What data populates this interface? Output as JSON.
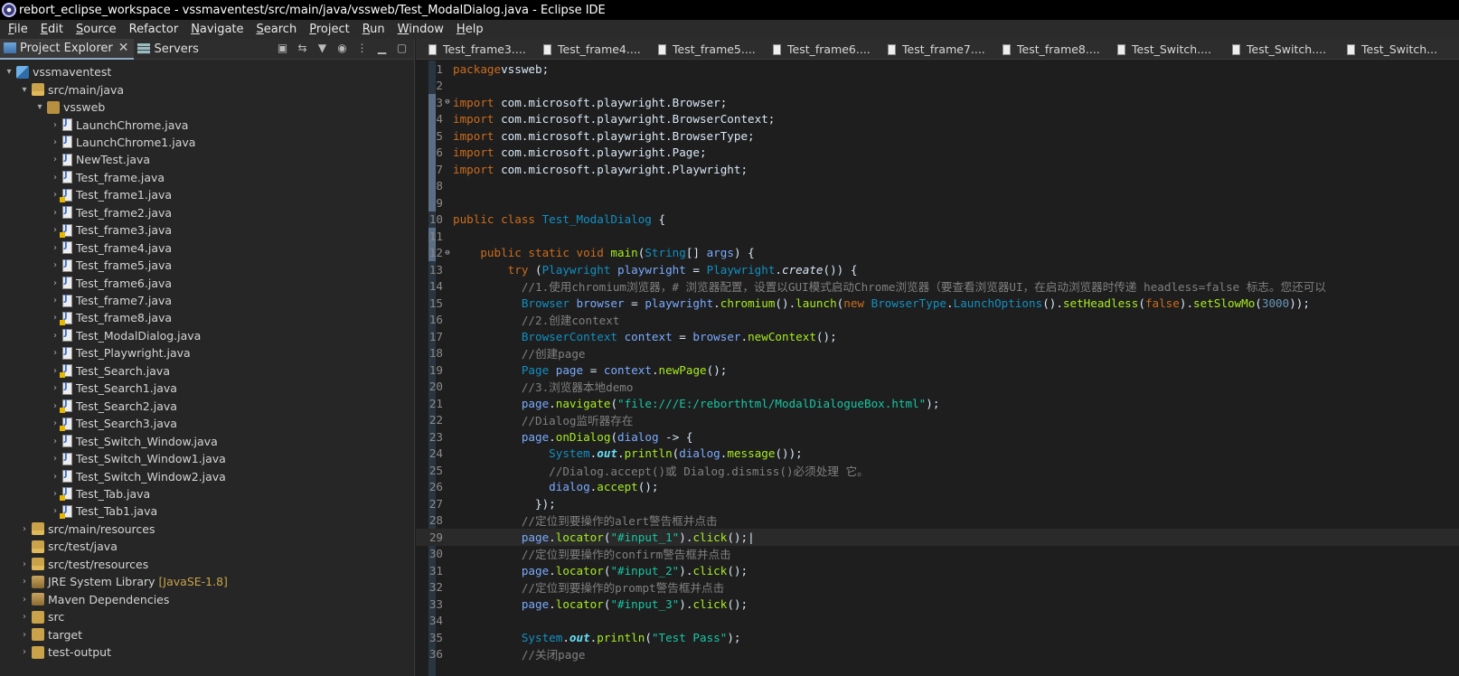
{
  "window": {
    "title": "rebort_eclipse_workspace - vssmaventest/src/main/java/vssweb/Test_ModalDialog.java - Eclipse IDE"
  },
  "menu": [
    {
      "mn": "F",
      "rest": "ile"
    },
    {
      "mn": "E",
      "rest": "dit"
    },
    {
      "mn": "S",
      "rest": "ource"
    },
    {
      "mn": "",
      "rest": "Refactor"
    },
    {
      "mn": "N",
      "rest": "avigate"
    },
    {
      "mn": "S",
      "rest": "earch"
    },
    {
      "mn": "P",
      "rest": "roject"
    },
    {
      "mn": "R",
      "rest": "un"
    },
    {
      "mn": "W",
      "rest": "indow"
    },
    {
      "mn": "H",
      "rest": "elp"
    }
  ],
  "left_panel": {
    "tabs": [
      {
        "label": "Project Explorer",
        "close": "✕"
      },
      {
        "label": "Servers"
      }
    ],
    "tree": [
      {
        "indent": 0,
        "arrow": "▾",
        "icon": "project",
        "label": "vssmaventest"
      },
      {
        "indent": 1,
        "arrow": "▾",
        "icon": "srcfolder",
        "label": "src/main/java"
      },
      {
        "indent": 2,
        "arrow": "▾",
        "icon": "package",
        "label": "vssweb"
      },
      {
        "indent": 3,
        "arrow": "›",
        "icon": "java",
        "label": "LaunchChrome.java"
      },
      {
        "indent": 3,
        "arrow": "›",
        "icon": "java",
        "label": "LaunchChrome1.java"
      },
      {
        "indent": 3,
        "arrow": "›",
        "icon": "java",
        "label": "NewTest.java"
      },
      {
        "indent": 3,
        "arrow": "›",
        "icon": "java",
        "label": "Test_frame.java"
      },
      {
        "indent": 3,
        "arrow": "›",
        "icon": "javawarn",
        "label": "Test_frame1.java"
      },
      {
        "indent": 3,
        "arrow": "›",
        "icon": "java",
        "label": "Test_frame2.java"
      },
      {
        "indent": 3,
        "arrow": "›",
        "icon": "javawarn",
        "label": "Test_frame3.java"
      },
      {
        "indent": 3,
        "arrow": "›",
        "icon": "java",
        "label": "Test_frame4.java"
      },
      {
        "indent": 3,
        "arrow": "›",
        "icon": "java",
        "label": "Test_frame5.java"
      },
      {
        "indent": 3,
        "arrow": "›",
        "icon": "java",
        "label": "Test_frame6.java"
      },
      {
        "indent": 3,
        "arrow": "›",
        "icon": "java",
        "label": "Test_frame7.java"
      },
      {
        "indent": 3,
        "arrow": "›",
        "icon": "javawarn",
        "label": "Test_frame8.java"
      },
      {
        "indent": 3,
        "arrow": "›",
        "icon": "java",
        "label": "Test_ModalDialog.java"
      },
      {
        "indent": 3,
        "arrow": "›",
        "icon": "java",
        "label": "Test_Playwright.java"
      },
      {
        "indent": 3,
        "arrow": "›",
        "icon": "javawarn",
        "label": "Test_Search.java"
      },
      {
        "indent": 3,
        "arrow": "›",
        "icon": "java",
        "label": "Test_Search1.java"
      },
      {
        "indent": 3,
        "arrow": "›",
        "icon": "javawarn",
        "label": "Test_Search2.java"
      },
      {
        "indent": 3,
        "arrow": "›",
        "icon": "javawarn",
        "label": "Test_Search3.java"
      },
      {
        "indent": 3,
        "arrow": "›",
        "icon": "java",
        "label": "Test_Switch_Window.java"
      },
      {
        "indent": 3,
        "arrow": "›",
        "icon": "java",
        "label": "Test_Switch_Window1.java"
      },
      {
        "indent": 3,
        "arrow": "›",
        "icon": "java",
        "label": "Test_Switch_Window2.java"
      },
      {
        "indent": 3,
        "arrow": "›",
        "icon": "javawarn",
        "label": "Test_Tab.java"
      },
      {
        "indent": 3,
        "arrow": "›",
        "icon": "javawarn",
        "label": "Test_Tab1.java"
      },
      {
        "indent": 1,
        "arrow": "›",
        "icon": "srcfolder",
        "label": "src/main/resources"
      },
      {
        "indent": 1,
        "arrow": "",
        "icon": "srcfolder",
        "label": "src/test/java"
      },
      {
        "indent": 1,
        "arrow": "›",
        "icon": "srcfolder",
        "label": "src/test/resources"
      },
      {
        "indent": 1,
        "arrow": "›",
        "icon": "lib",
        "label": "JRE System Library",
        "decor": "[JavaSE-1.8]"
      },
      {
        "indent": 1,
        "arrow": "›",
        "icon": "lib",
        "label": "Maven Dependencies"
      },
      {
        "indent": 1,
        "arrow": "›",
        "icon": "folder",
        "label": "src"
      },
      {
        "indent": 1,
        "arrow": "›",
        "icon": "folder",
        "label": "target"
      },
      {
        "indent": 1,
        "arrow": "›",
        "icon": "folder",
        "label": "test-output"
      }
    ]
  },
  "editor": {
    "tabs": [
      "Test_frame3....",
      "Test_frame4....",
      "Test_frame5....",
      "Test_frame6....",
      "Test_frame7....",
      "Test_frame8....",
      "Test_Switch....",
      "Test_Switch....",
      "Test_Switch..."
    ],
    "current_line": 29,
    "lines": [
      {
        "n": "1",
        "t": [
          [
            "kw",
            "package"
          ],
          [
            "",
            "vssweb;"
          ]
        ]
      },
      {
        "n": "2",
        "t": []
      },
      {
        "n": "3",
        "fold": "⊖",
        "t": [
          [
            "kw",
            "import"
          ],
          [
            "",
            " com.microsoft.playwright.Browser;"
          ]
        ]
      },
      {
        "n": "4",
        "t": [
          [
            "kw",
            "import"
          ],
          [
            "",
            " com.microsoft.playwright.BrowserContext;"
          ]
        ]
      },
      {
        "n": "5",
        "t": [
          [
            "kw",
            "import"
          ],
          [
            "",
            " com.microsoft.playwright.BrowserType;"
          ]
        ]
      },
      {
        "n": "6",
        "t": [
          [
            "kw",
            "import"
          ],
          [
            "",
            " com.microsoft.playwright.Page;"
          ]
        ]
      },
      {
        "n": "7",
        "t": [
          [
            "kw",
            "import"
          ],
          [
            "",
            " com.microsoft.playwright.Playwright;"
          ]
        ]
      },
      {
        "n": "8",
        "t": []
      },
      {
        "n": "9",
        "t": []
      },
      {
        "n": "10",
        "t": [
          [
            "kw",
            "public class "
          ],
          [
            "ty",
            "Test_ModalDialog"
          ],
          [
            "",
            " {"
          ]
        ]
      },
      {
        "n": "11",
        "t": []
      },
      {
        "n": "12",
        "fold": "⊖",
        "t": [
          [
            "",
            "    "
          ],
          [
            "kw",
            "public static void "
          ],
          [
            "fn",
            "main"
          ],
          [
            "",
            "("
          ],
          [
            "ty",
            "String"
          ],
          [
            "",
            "[] "
          ],
          [
            "va",
            "args"
          ],
          [
            "",
            ") {"
          ]
        ]
      },
      {
        "n": "13",
        "t": [
          [
            "",
            "        "
          ],
          [
            "kw",
            "try"
          ],
          [
            "",
            " ("
          ],
          [
            "ty",
            "Playwright"
          ],
          [
            "",
            " "
          ],
          [
            "va",
            "playwright"
          ],
          [
            "",
            " = "
          ],
          [
            "ty",
            "Playwright"
          ],
          [
            "",
            "."
          ],
          [
            "it",
            "create"
          ],
          [
            "",
            "()) {"
          ]
        ]
      },
      {
        "n": "14",
        "t": [
          [
            "cm",
            "          //1.使用chromium浏览器，# 浏览器配置，设置以GUI模式启动Chrome浏览器（要查看浏览器UI，在启动浏览器时传递 headless=false 标志。您还可以"
          ]
        ]
      },
      {
        "n": "15",
        "t": [
          [
            "",
            "          "
          ],
          [
            "ty",
            "Browser"
          ],
          [
            "",
            " "
          ],
          [
            "va",
            "browser"
          ],
          [
            "",
            " = "
          ],
          [
            "va",
            "playwright"
          ],
          [
            "",
            "."
          ],
          [
            "fn",
            "chromium"
          ],
          [
            "",
            "()."
          ],
          [
            "fn",
            "launch"
          ],
          [
            "",
            "("
          ],
          [
            "kw",
            "new "
          ],
          [
            "ty",
            "BrowserType"
          ],
          [
            "",
            "."
          ],
          [
            "ty",
            "LaunchOptions"
          ],
          [
            "",
            "()."
          ],
          [
            "fn",
            "setHeadless"
          ],
          [
            "",
            "("
          ],
          [
            "kw",
            "false"
          ],
          [
            "",
            ")."
          ],
          [
            "fn",
            "setSlowMo"
          ],
          [
            "",
            "("
          ],
          [
            "nm",
            "3000"
          ],
          [
            "",
            "));"
          ]
        ]
      },
      {
        "n": "16",
        "t": [
          [
            "cm",
            "          //2.创建context"
          ]
        ]
      },
      {
        "n": "17",
        "t": [
          [
            "",
            "          "
          ],
          [
            "ty",
            "BrowserContext"
          ],
          [
            "",
            " "
          ],
          [
            "va",
            "context"
          ],
          [
            "",
            " = "
          ],
          [
            "va",
            "browser"
          ],
          [
            "",
            "."
          ],
          [
            "fn",
            "newContext"
          ],
          [
            "",
            "();"
          ]
        ]
      },
      {
        "n": "18",
        "t": [
          [
            "cm",
            "          //创建page"
          ]
        ]
      },
      {
        "n": "19",
        "t": [
          [
            "",
            "          "
          ],
          [
            "ty",
            "Page"
          ],
          [
            "",
            " "
          ],
          [
            "va",
            "page"
          ],
          [
            "",
            " = "
          ],
          [
            "va",
            "context"
          ],
          [
            "",
            "."
          ],
          [
            "fn",
            "newPage"
          ],
          [
            "",
            "();"
          ]
        ]
      },
      {
        "n": "20",
        "t": [
          [
            "cm",
            "          //3.浏览器本地demo"
          ]
        ]
      },
      {
        "n": "21",
        "t": [
          [
            "",
            "          "
          ],
          [
            "va",
            "page"
          ],
          [
            "",
            "."
          ],
          [
            "fn",
            "navigate"
          ],
          [
            "",
            "("
          ],
          [
            "st",
            "\"file:///E:/reborthtml/ModalDialogueBox.html\""
          ],
          [
            "",
            ");"
          ]
        ]
      },
      {
        "n": "22",
        "t": [
          [
            "cm",
            "          //Dialog监听器存在"
          ]
        ]
      },
      {
        "n": "23",
        "t": [
          [
            "",
            "          "
          ],
          [
            "va",
            "page"
          ],
          [
            "",
            "."
          ],
          [
            "fn",
            "onDialog"
          ],
          [
            "",
            "("
          ],
          [
            "va",
            "dialog"
          ],
          [
            "",
            " -> {"
          ]
        ]
      },
      {
        "n": "24",
        "t": [
          [
            "",
            "              "
          ],
          [
            "ty",
            "System"
          ],
          [
            "",
            "."
          ],
          [
            "fld",
            "out"
          ],
          [
            "",
            "."
          ],
          [
            "fn",
            "println"
          ],
          [
            "",
            "("
          ],
          [
            "va",
            "dialog"
          ],
          [
            "",
            "."
          ],
          [
            "fn",
            "message"
          ],
          [
            "",
            "());"
          ]
        ]
      },
      {
        "n": "25",
        "t": [
          [
            "cm",
            "              //Dialog.accept()或 Dialog.dismiss()必须处理 它。"
          ]
        ]
      },
      {
        "n": "26",
        "t": [
          [
            "",
            "              "
          ],
          [
            "va",
            "dialog"
          ],
          [
            "",
            "."
          ],
          [
            "fn",
            "accept"
          ],
          [
            "",
            "();"
          ]
        ]
      },
      {
        "n": "27",
        "t": [
          [
            "",
            "            });"
          ]
        ]
      },
      {
        "n": "28",
        "t": [
          [
            "cm",
            "          //定位到要操作的alert警告框并点击"
          ]
        ]
      },
      {
        "n": "29",
        "t": [
          [
            "",
            "          "
          ],
          [
            "va",
            "page"
          ],
          [
            "",
            "."
          ],
          [
            "fn",
            "locator"
          ],
          [
            "",
            "("
          ],
          [
            "st",
            "\"#input_1\""
          ],
          [
            "",
            ")."
          ],
          [
            "fn",
            "click"
          ],
          [
            "",
            "();|"
          ]
        ]
      },
      {
        "n": "30",
        "t": [
          [
            "cm",
            "          //定位到要操作的confirm警告框并点击"
          ]
        ]
      },
      {
        "n": "31",
        "t": [
          [
            "",
            "          "
          ],
          [
            "va",
            "page"
          ],
          [
            "",
            "."
          ],
          [
            "fn",
            "locator"
          ],
          [
            "",
            "("
          ],
          [
            "st",
            "\"#input_2\""
          ],
          [
            "",
            ")."
          ],
          [
            "fn",
            "click"
          ],
          [
            "",
            "();"
          ]
        ]
      },
      {
        "n": "32",
        "t": [
          [
            "cm",
            "          //定位到要操作的prompt警告框并点击"
          ]
        ]
      },
      {
        "n": "33",
        "t": [
          [
            "",
            "          "
          ],
          [
            "va",
            "page"
          ],
          [
            "",
            "."
          ],
          [
            "fn",
            "locator"
          ],
          [
            "",
            "("
          ],
          [
            "st",
            "\"#input_3\""
          ],
          [
            "",
            ")."
          ],
          [
            "fn",
            "click"
          ],
          [
            "",
            "();"
          ]
        ]
      },
      {
        "n": "34",
        "t": []
      },
      {
        "n": "35",
        "t": [
          [
            "",
            "          "
          ],
          [
            "ty",
            "System"
          ],
          [
            "",
            "."
          ],
          [
            "fld",
            "out"
          ],
          [
            "",
            "."
          ],
          [
            "fn",
            "println"
          ],
          [
            "",
            "("
          ],
          [
            "st",
            "\"Test Pass\""
          ],
          [
            "",
            ");"
          ]
        ]
      },
      {
        "n": "36",
        "t": [
          [
            "cm",
            "          //关闭page"
          ]
        ]
      }
    ]
  }
}
